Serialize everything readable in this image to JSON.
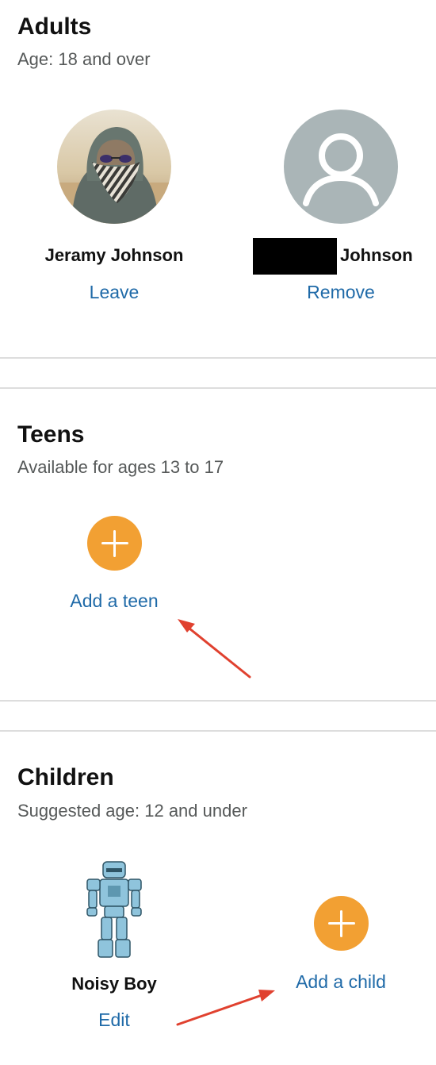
{
  "adults": {
    "title": "Adults",
    "subtitle": "Age: 18 and over",
    "members": [
      {
        "name": "Jeramy Johnson",
        "action": "Leave"
      },
      {
        "name": "Johnson",
        "action": "Remove"
      }
    ]
  },
  "teens": {
    "title": "Teens",
    "subtitle": "Available for ages 13 to 17",
    "add_label": "Add a teen"
  },
  "children": {
    "title": "Children",
    "subtitle": "Suggested age: 12 and under",
    "members": [
      {
        "name": "Noisy Boy",
        "action": "Edit"
      }
    ],
    "add_label": "Add a child"
  },
  "colors": {
    "link": "#1f6aa8",
    "add_button": "#f2a033",
    "annotation_arrow": "#e0412f",
    "placeholder_avatar": "#aab5b7"
  },
  "icons": {
    "placeholder_avatar": "person-silhouette-icon",
    "add": "plus-icon"
  }
}
